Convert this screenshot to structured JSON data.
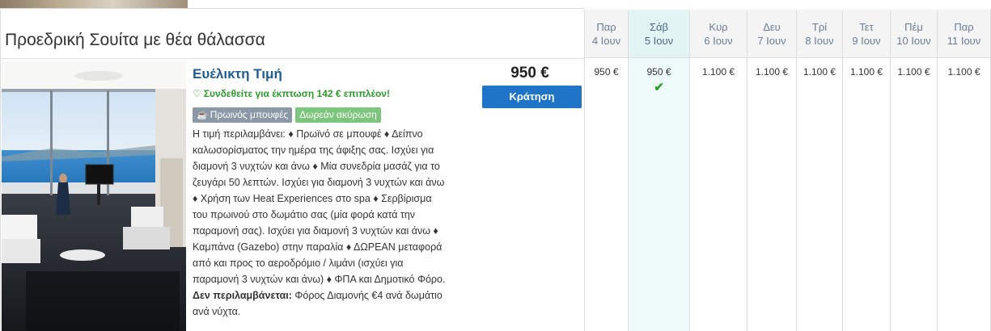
{
  "room": {
    "title": "Προεδρική Σουίτα με θέα θάλασσα"
  },
  "rate": {
    "name": "Ευέλικτη Τιμή",
    "login_promo": "Συνδεθείτε για έκπτωση 142 € επιπλέον!",
    "badges": [
      {
        "label": "Πρωινός μπουφές",
        "icon": "coffee-cup-icon"
      },
      {
        "label": "Δωρεάν ακύρωση"
      }
    ],
    "description_lines": [
      "Η τιμή περιλαμβάνει: ♦ Πρωϊνό σε μπουφέ ♦ Δείπνο",
      "καλωσορίσματος την ημέρα της άφιξης σας. Ισχύει για",
      "διαμονή 3 νυχτών και άνω ♦ Μία συνεδρία μασάζ για το",
      "ζευγάρι 50 λεπτών. Ισχύει για διαμονή 3 νυχτών και άνω",
      "♦ Χρήση των Heat Experiences στο spa ♦ Σερβίρισμα",
      "του πρωινού στο δωμάτιο σας (μία φορά κατά την",
      "παραμονή σας). Ισχύει για διαμονή 3 νυχτών και άνω ♦",
      "Καμπάνα (Gazebo) στην παραλία ♦ ΔΩΡΕΑΝ μεταφορά",
      "από και προς το αεροδρόμιο / λιμάνι (ισχύει για",
      "παραμονή 3 νυχτών και άνω) ♦ ΦΠΑ και Δημοτικό Φόρο."
    ],
    "not_included_label": "Δεν περιλαμβάνεται:",
    "not_included_line1": "Φόρος Διαμονής €4 ανά δωμάτιο",
    "not_included_line2": "ανά νύχτα.",
    "price": "950 €",
    "book_label": "Κράτηση"
  },
  "calendar": {
    "selected_index": 1,
    "days": [
      {
        "day": "Παρ",
        "date": "4 Ιουν",
        "price": "950 €"
      },
      {
        "day": "Σάβ",
        "date": "5 Ιουν",
        "price": "950 €",
        "selected": true
      },
      {
        "day": "Κυρ",
        "date": "6 Ιουν",
        "price": "1.100 €"
      },
      {
        "day": "Δευ",
        "date": "7 Ιουν",
        "price": "1.100 €"
      },
      {
        "day": "Τρί",
        "date": "8 Ιουν",
        "price": "1.100 €"
      },
      {
        "day": "Τετ",
        "date": "9 Ιουν",
        "price": "1.100 €"
      },
      {
        "day": "Πέμ",
        "date": "10 Ιουν",
        "price": "1.100 €"
      },
      {
        "day": "Παρ",
        "date": "11 Ιουν",
        "price": "1.100 €"
      }
    ]
  },
  "colors": {
    "rate_name": "#1f5c96",
    "promo_green": "#2c9a2c",
    "book_button": "#1f74c8",
    "selected_column": "#eefafa"
  }
}
